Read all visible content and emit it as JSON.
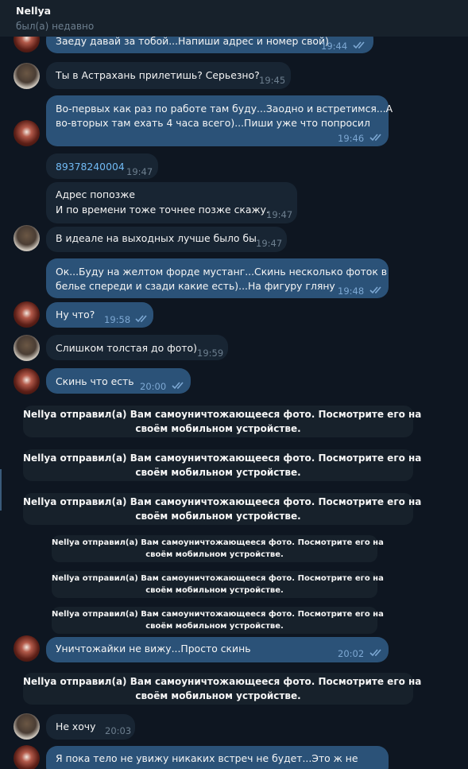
{
  "header": {
    "title": "Nellya",
    "status": "был(а) недавно"
  },
  "messages": [
    {
      "id": "m1",
      "type": "out",
      "text": "Заеду давай за тобой...Напиши адрес и номер свой)",
      "time": "19:44",
      "read": true
    },
    {
      "id": "m2",
      "type": "in",
      "text": "Ты в Астрахань прилетишь? Серьезно?",
      "time": "19:45"
    },
    {
      "id": "m3",
      "type": "out",
      "line1": "Во-первых как раз по работе там буду...Заодно и встретимся...А",
      "line2": "во-вторых там ехать 4 часа всего)...Пиши уже что попросил",
      "time": "19:46",
      "read": true
    },
    {
      "id": "m4",
      "type": "in",
      "text": "89378240004",
      "time": "19:47",
      "is_link": true
    },
    {
      "id": "m5",
      "type": "in",
      "line1": "Адрес попозже",
      "line2": "И по времени тоже точнее позже скажу.",
      "time": "19:47"
    },
    {
      "id": "m6",
      "type": "in",
      "text": "В идеале на выходных лучше было бы",
      "time": "19:47"
    },
    {
      "id": "m7",
      "type": "out",
      "line1": "Ок...Буду на желтом форде мустанг...Скинь несколько фоток в",
      "line2": "белье спереди и сзади какие есть)...На фигуру гляну",
      "time": "19:48",
      "read": true
    },
    {
      "id": "m8",
      "type": "out",
      "text": "Ну что?",
      "time": "19:58",
      "read": true
    },
    {
      "id": "m9",
      "type": "in",
      "text": "Слишком толстая до фото)",
      "time": "19:59"
    },
    {
      "id": "m10",
      "type": "out",
      "text": "Скинь что есть",
      "time": "20:00",
      "read": true
    },
    {
      "id": "m11",
      "type": "out",
      "text": "Уничтожайки не вижу...Просто скинь",
      "time": "20:02",
      "read": true
    },
    {
      "id": "m12",
      "type": "in",
      "text": "Не хочу",
      "time": "20:03"
    },
    {
      "id": "m13",
      "type": "out",
      "text": "Я пока тело не увижу никаких встреч не будет...Это ж не"
    }
  ],
  "system_notice": {
    "line1": "Nellya отправил(а) Вам самоуничтожающееся фото. Посмотрите его на",
    "line2": "своём мобильном устройстве."
  }
}
